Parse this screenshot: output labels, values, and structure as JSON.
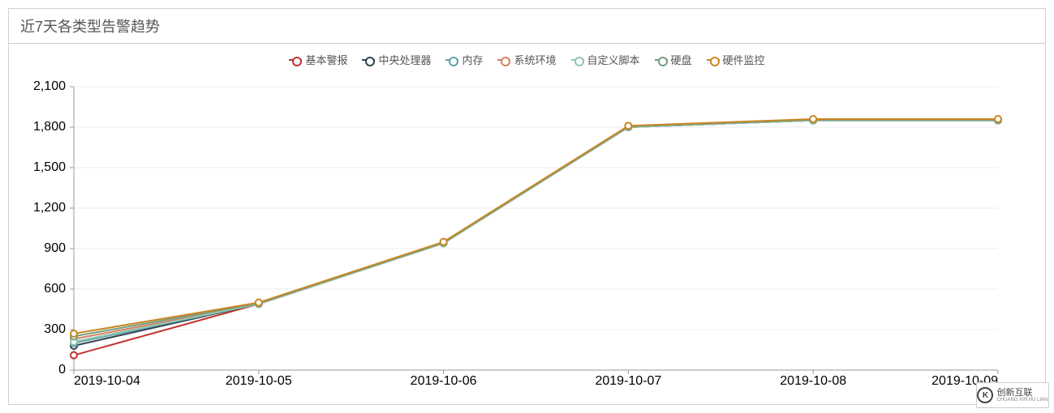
{
  "panel": {
    "title": "近7天各类型告警趋势"
  },
  "legend": {
    "items": [
      {
        "label": "基本警报",
        "color": "#c23531"
      },
      {
        "label": "中央处理器",
        "color": "#2f4554"
      },
      {
        "label": "内存",
        "color": "#61a0a8"
      },
      {
        "label": "系统环境",
        "color": "#d48265"
      },
      {
        "label": "自定义脚本",
        "color": "#91c7ae"
      },
      {
        "label": "硬盘",
        "color": "#749f83"
      },
      {
        "label": "硬件监控",
        "color": "#ca8622"
      }
    ]
  },
  "watermark": {
    "text": "创新互联",
    "sub": "CHUANG XIN HU LIAN"
  },
  "chart_data": {
    "type": "line",
    "title": "近7天各类型告警趋势",
    "xlabel": "",
    "ylabel": "",
    "ylim": [
      0,
      2100
    ],
    "yticks": [
      0,
      300,
      600,
      900,
      1200,
      1500,
      1800,
      2100
    ],
    "categories": [
      "2019-10-04",
      "2019-10-05",
      "2019-10-06",
      "2019-10-07",
      "2019-10-08",
      "2019-10-09"
    ],
    "series": [
      {
        "name": "基本警报",
        "color": "#c23531",
        "values": [
          110,
          490,
          940,
          1800,
          1850,
          1850
        ]
      },
      {
        "name": "中央处理器",
        "color": "#2f4554",
        "values": [
          180,
          490,
          940,
          1800,
          1850,
          1850
        ]
      },
      {
        "name": "内存",
        "color": "#61a0a8",
        "values": [
          200,
          490,
          940,
          1800,
          1850,
          1850
        ]
      },
      {
        "name": "系统环境",
        "color": "#d48265",
        "values": [
          230,
          490,
          940,
          1800,
          1850,
          1850
        ]
      },
      {
        "name": "自定义脚本",
        "color": "#91c7ae",
        "values": [
          210,
          490,
          940,
          1800,
          1850,
          1850
        ]
      },
      {
        "name": "硬盘",
        "color": "#749f83",
        "values": [
          250,
          495,
          945,
          1805,
          1855,
          1855
        ]
      },
      {
        "name": "硬件监控",
        "color": "#ca8622",
        "values": [
          270,
          500,
          950,
          1810,
          1860,
          1860
        ]
      }
    ]
  }
}
